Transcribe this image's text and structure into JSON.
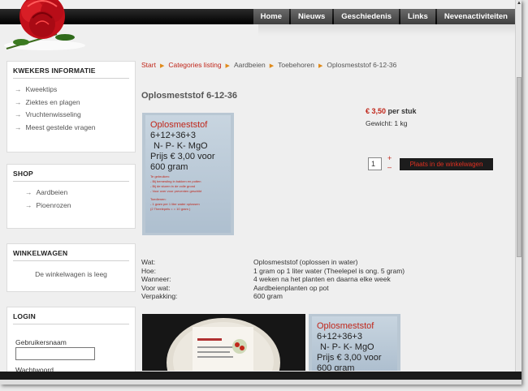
{
  "nav": {
    "items": [
      "Home",
      "Nieuws",
      "Geschiedenis",
      "Links",
      "Nevenactiviteiten"
    ]
  },
  "sidebar": {
    "kwekers": {
      "title": "KWEKERS INFORMATIE",
      "items": [
        "Kweektips",
        "Ziektes en plagen",
        "Vruchtenwisseling",
        "Meest gestelde vragen"
      ]
    },
    "shop": {
      "title": "SHOP",
      "items": [
        "Aardbeien",
        "Pioenrozen"
      ]
    },
    "cart": {
      "title": "WINKELWAGEN",
      "empty_text": "De winkelwagen is leeg"
    },
    "login": {
      "title": "LOGIN",
      "username_label": "Gebruikersnaam",
      "password_label": "Wachtwoord"
    }
  },
  "breadcrumb": {
    "links": [
      "Start",
      "Categories listing"
    ],
    "plain": [
      "Aardbeien",
      "Toebehoren",
      "Oplosmeststof 6-12-36"
    ]
  },
  "product": {
    "title": "Oplosmeststof 6-12-36",
    "price": "€ 3,50",
    "price_unit": "per stuk",
    "weight": "Gewicht: 1 kg",
    "qty": "1",
    "plus": "+",
    "minus": "–",
    "cart_button": "Plaats in de winkelwagen",
    "image_text": {
      "line1": "Oplosmeststof",
      "line2": "6+12+36+3",
      "line3": "N- P-  K- MgO",
      "line4": "Prijs € 3,00 voor",
      "line5": "600 gram",
      "small1": "Te gebruiken:",
      "small2": "- Bij bemesting in bakken en potten",
      "small3": "- Bij de sturen in de volle grond",
      "small4": "- Voor over voor preventen geschikt",
      "small5": "Toedienen:",
      "small6": "- 1 gram per 1 liter water oplossen",
      "small7": "(2 Theelepels = = 10 gram )"
    },
    "specs": [
      {
        "k": "Wat:",
        "v": "Oplosmeststof (oplossen in water)"
      },
      {
        "k": "Hoe:",
        "v": "1 gram op 1 liter water (Theelepel is ong. 5 gram)"
      },
      {
        "k": "Wanneer:",
        "v": "4 weken na het planten en daarna elke week"
      },
      {
        "k": "Voor wat:",
        "v": "Aardbeienplanten op pot"
      },
      {
        "k": "Verpakking:",
        "v": "600 gram"
      }
    ]
  },
  "colors": {
    "accent": "#c0261a",
    "crumb_sep": "#e08a1a",
    "nav_bg": "#000000"
  }
}
